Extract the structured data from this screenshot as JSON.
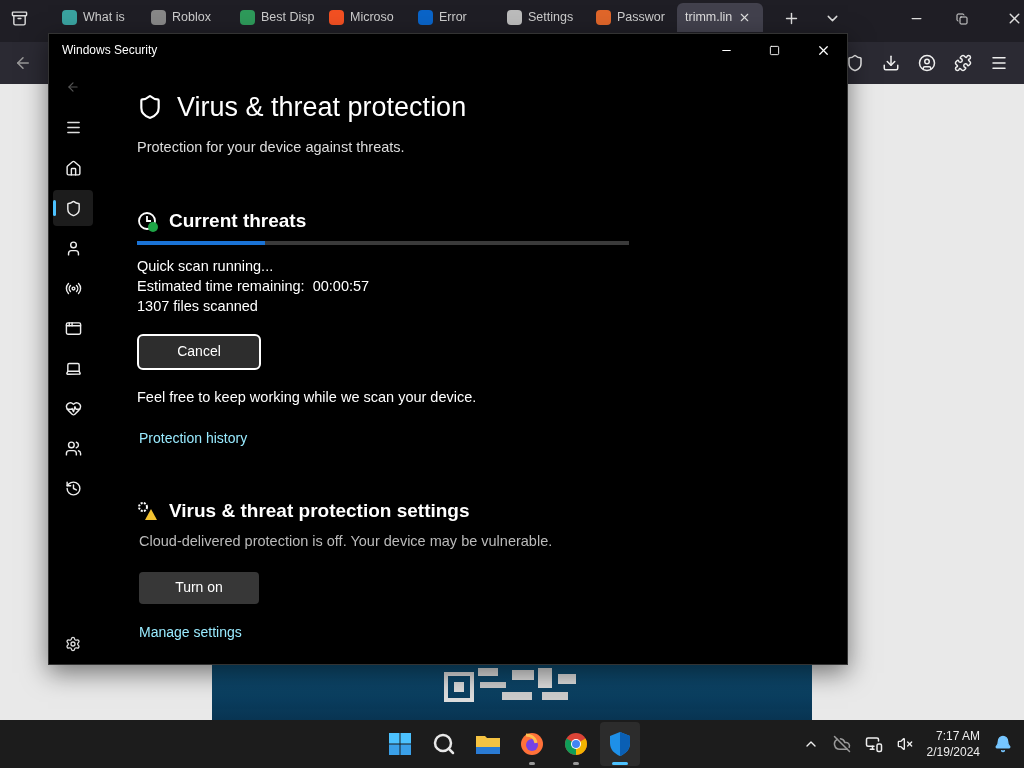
{
  "browser": {
    "tabs": [
      {
        "label": "What is ",
        "selected": false
      },
      {
        "label": "Roblox",
        "selected": false
      },
      {
        "label": "Best Disp",
        "selected": false
      },
      {
        "label": "Microso",
        "selected": false
      },
      {
        "label": "Error",
        "selected": false
      },
      {
        "label": "Settings",
        "selected": false
      },
      {
        "label": "Passwor",
        "selected": false
      },
      {
        "label": "trimm.lin",
        "selected": true
      }
    ]
  },
  "window": {
    "title": "Windows Security"
  },
  "sidebar": {
    "items": [
      {
        "kind": "home",
        "selected": false
      },
      {
        "kind": "shield",
        "selected": true
      },
      {
        "kind": "account",
        "selected": false
      },
      {
        "kind": "network",
        "selected": false
      },
      {
        "kind": "app",
        "selected": false
      },
      {
        "kind": "device",
        "selected": false
      },
      {
        "kind": "health",
        "selected": false
      },
      {
        "kind": "family",
        "selected": false
      },
      {
        "kind": "history",
        "selected": false
      }
    ]
  },
  "page": {
    "title": "Virus & threat protection",
    "subtitle": "Protection for your device against threats.",
    "threats": {
      "heading": "Current threats",
      "scan": {
        "level": 0.26
      },
      "lines": [
        "Quick scan running...",
        "Estimated time remaining:  00:00:57",
        "1307 files scanned"
      ],
      "cancel": "Cancel",
      "note": "Feel free to keep working while we scan your device.",
      "link": "Protection history"
    },
    "settings": {
      "heading": "Virus & threat protection settings",
      "warning": "Cloud-delivered protection is off. Your device may be vulnerable.",
      "button": "Turn on",
      "link": "Manage settings"
    }
  },
  "taskbar": {
    "apps": [
      {
        "kind": "start",
        "running": false,
        "active": false
      },
      {
        "kind": "search",
        "running": false,
        "active": false
      },
      {
        "kind": "folder",
        "running": false,
        "active": false
      },
      {
        "kind": "firefox",
        "running": true,
        "active": false
      },
      {
        "kind": "chrome",
        "running": true,
        "active": false
      },
      {
        "kind": "security",
        "running": true,
        "active": true
      }
    ],
    "time": "7:17 AM",
    "date": "2/19/2024"
  }
}
